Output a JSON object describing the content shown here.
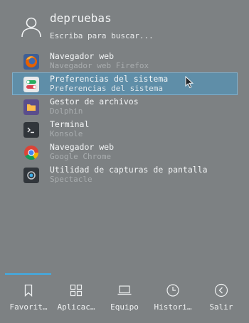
{
  "user": {
    "name": "depruebas"
  },
  "search": {
    "placeholder": "Escriba para buscar..."
  },
  "results": [
    {
      "name": "Navegador web",
      "description": "Navegador web Firefox",
      "icon": "firefox-icon"
    },
    {
      "name": "Preferencias del sistema",
      "description": "Preferencias del sistema",
      "icon": "system-settings-icon"
    },
    {
      "name": "Gestor de archivos",
      "description": "Dolphin",
      "icon": "folder-icon"
    },
    {
      "name": "Terminal",
      "description": "Konsole",
      "icon": "terminal-icon"
    },
    {
      "name": "Navegador web",
      "description": "Google Chrome",
      "icon": "chrome-icon"
    },
    {
      "name": "Utilidad de capturas de pantalla",
      "description": "Spectacle",
      "icon": "camera-icon"
    }
  ],
  "tabs": [
    {
      "label": "Favorit…",
      "icon": "bookmark-icon"
    },
    {
      "label": "Aplicac…",
      "icon": "applications-grid-icon"
    },
    {
      "label": "Equipo",
      "icon": "computer-icon"
    },
    {
      "label": "Histori…",
      "icon": "clock-icon"
    },
    {
      "label": "Salir",
      "icon": "back-arrow-circle-icon"
    }
  ],
  "colors": {
    "accent": "#3daee9",
    "highlight": "#5f8ea8",
    "background": "#7d8183"
  }
}
